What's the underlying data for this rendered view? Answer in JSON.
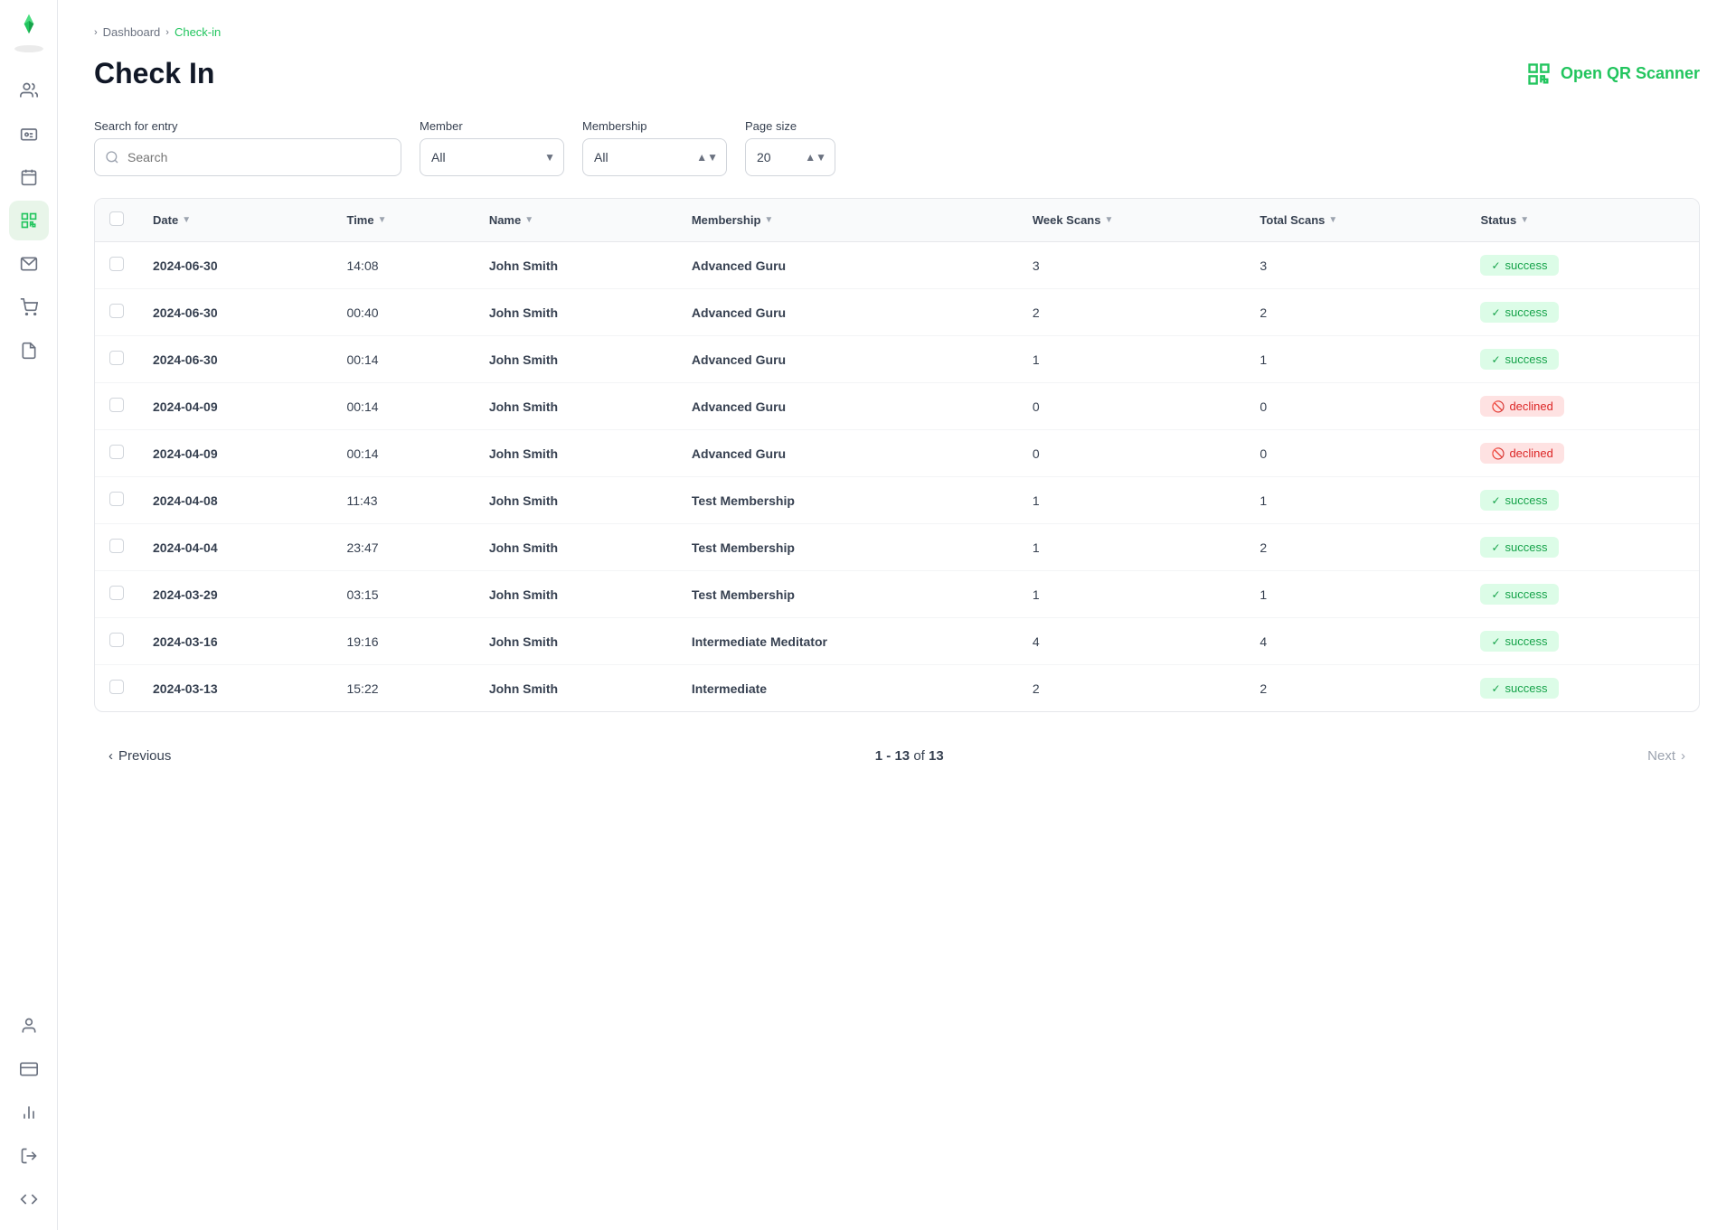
{
  "breadcrumb": {
    "home": "Dashboard",
    "current": "Check-in"
  },
  "page": {
    "title": "Check In",
    "qr_button_label": "Open QR Scanner"
  },
  "filters": {
    "search_label": "Search for entry",
    "search_placeholder": "Search",
    "member_label": "Member",
    "member_default": "All",
    "membership_label": "Membership",
    "membership_default": "All",
    "page_size_label": "Page size",
    "page_size_value": "20"
  },
  "table": {
    "columns": [
      "Date",
      "Time",
      "Name",
      "Membership",
      "Week Scans",
      "Total Scans",
      "Status"
    ],
    "rows": [
      {
        "date": "2024-06-30",
        "time": "14:08",
        "name": "John Smith",
        "membership": "Advanced Guru",
        "week_scans": "3",
        "total_scans": "3",
        "status": "success"
      },
      {
        "date": "2024-06-30",
        "time": "00:40",
        "name": "John Smith",
        "membership": "Advanced Guru",
        "week_scans": "2",
        "total_scans": "2",
        "status": "success"
      },
      {
        "date": "2024-06-30",
        "time": "00:14",
        "name": "John Smith",
        "membership": "Advanced Guru",
        "week_scans": "1",
        "total_scans": "1",
        "status": "success"
      },
      {
        "date": "2024-04-09",
        "time": "00:14",
        "name": "John Smith",
        "membership": "Advanced Guru",
        "week_scans": "0",
        "total_scans": "0",
        "status": "declined"
      },
      {
        "date": "2024-04-09",
        "time": "00:14",
        "name": "John Smith",
        "membership": "Advanced Guru",
        "week_scans": "0",
        "total_scans": "0",
        "status": "declined"
      },
      {
        "date": "2024-04-08",
        "time": "11:43",
        "name": "John Smith",
        "membership": "Test Membership",
        "week_scans": "1",
        "total_scans": "1",
        "status": "success"
      },
      {
        "date": "2024-04-04",
        "time": "23:47",
        "name": "John Smith",
        "membership": "Test Membership",
        "week_scans": "1",
        "total_scans": "2",
        "status": "success"
      },
      {
        "date": "2024-03-29",
        "time": "03:15",
        "name": "John Smith",
        "membership": "Test Membership",
        "week_scans": "1",
        "total_scans": "1",
        "status": "success"
      },
      {
        "date": "2024-03-16",
        "time": "19:16",
        "name": "John Smith",
        "membership": "Intermediate Meditator",
        "week_scans": "4",
        "total_scans": "4",
        "status": "success"
      },
      {
        "date": "2024-03-13",
        "time": "15:22",
        "name": "John Smith",
        "membership": "Intermediate",
        "week_scans": "2",
        "total_scans": "2",
        "status": "success"
      }
    ]
  },
  "pagination": {
    "current_range": "1 - 13",
    "total": "13",
    "label": "of",
    "prev_label": "Previous",
    "next_label": "Next"
  },
  "sidebar": {
    "items": [
      {
        "name": "people",
        "label": "People"
      },
      {
        "name": "id-card",
        "label": "ID Card"
      },
      {
        "name": "calendar",
        "label": "Calendar"
      },
      {
        "name": "qr-code",
        "label": "QR Code",
        "active": true
      },
      {
        "name": "mail",
        "label": "Mail"
      },
      {
        "name": "cart",
        "label": "Cart"
      },
      {
        "name": "file",
        "label": "File"
      }
    ],
    "bottom_items": [
      {
        "name": "person",
        "label": "Person"
      },
      {
        "name": "card",
        "label": "Card"
      },
      {
        "name": "chart",
        "label": "Chart"
      }
    ]
  }
}
